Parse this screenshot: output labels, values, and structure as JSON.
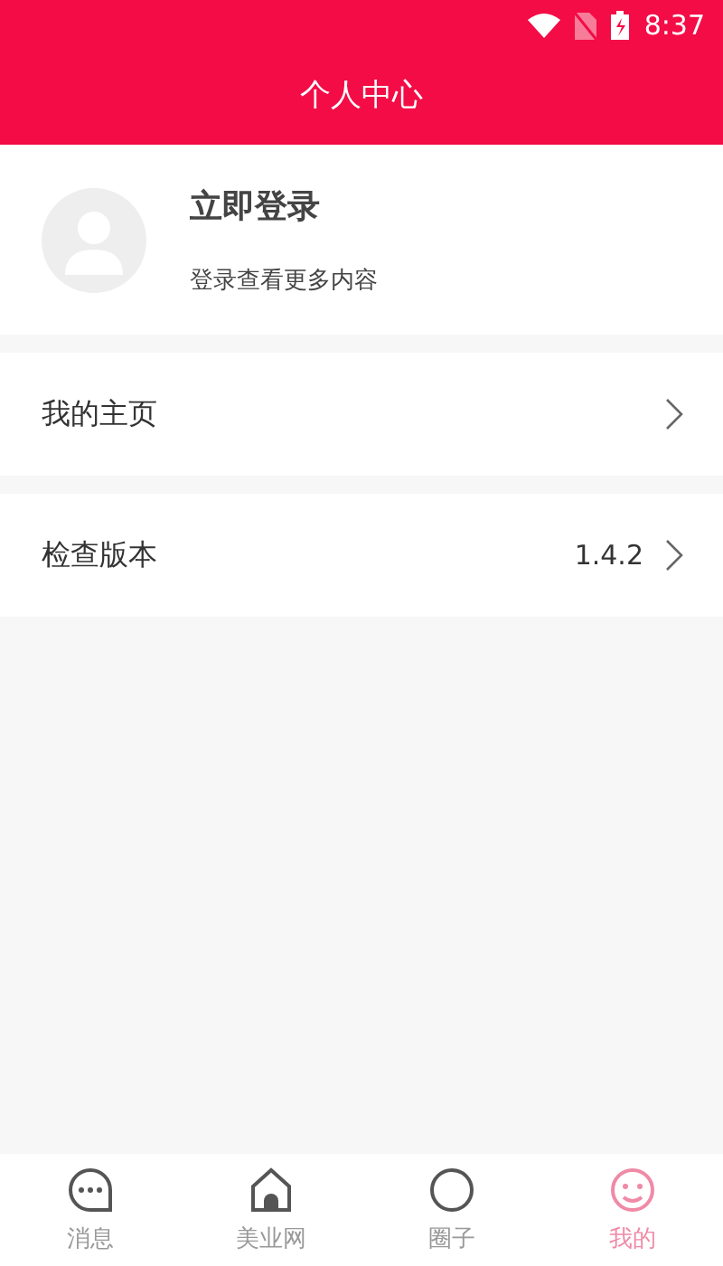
{
  "status_bar": {
    "time": "8:37"
  },
  "header": {
    "title": "个人中心"
  },
  "profile": {
    "name": "立即登录",
    "hint": "登录查看更多内容"
  },
  "menu": [
    {
      "label": "我的主页"
    },
    {
      "label": "检查版本",
      "value": "1.4.2"
    }
  ],
  "tab_bar": [
    {
      "label": "消息",
      "kind": "chat",
      "selected": false
    },
    {
      "label": "美业网",
      "kind": "home",
      "selected": false
    },
    {
      "label": "圈子",
      "kind": "circle",
      "selected": false
    },
    {
      "label": "我的",
      "kind": "face",
      "selected": true
    }
  ]
}
